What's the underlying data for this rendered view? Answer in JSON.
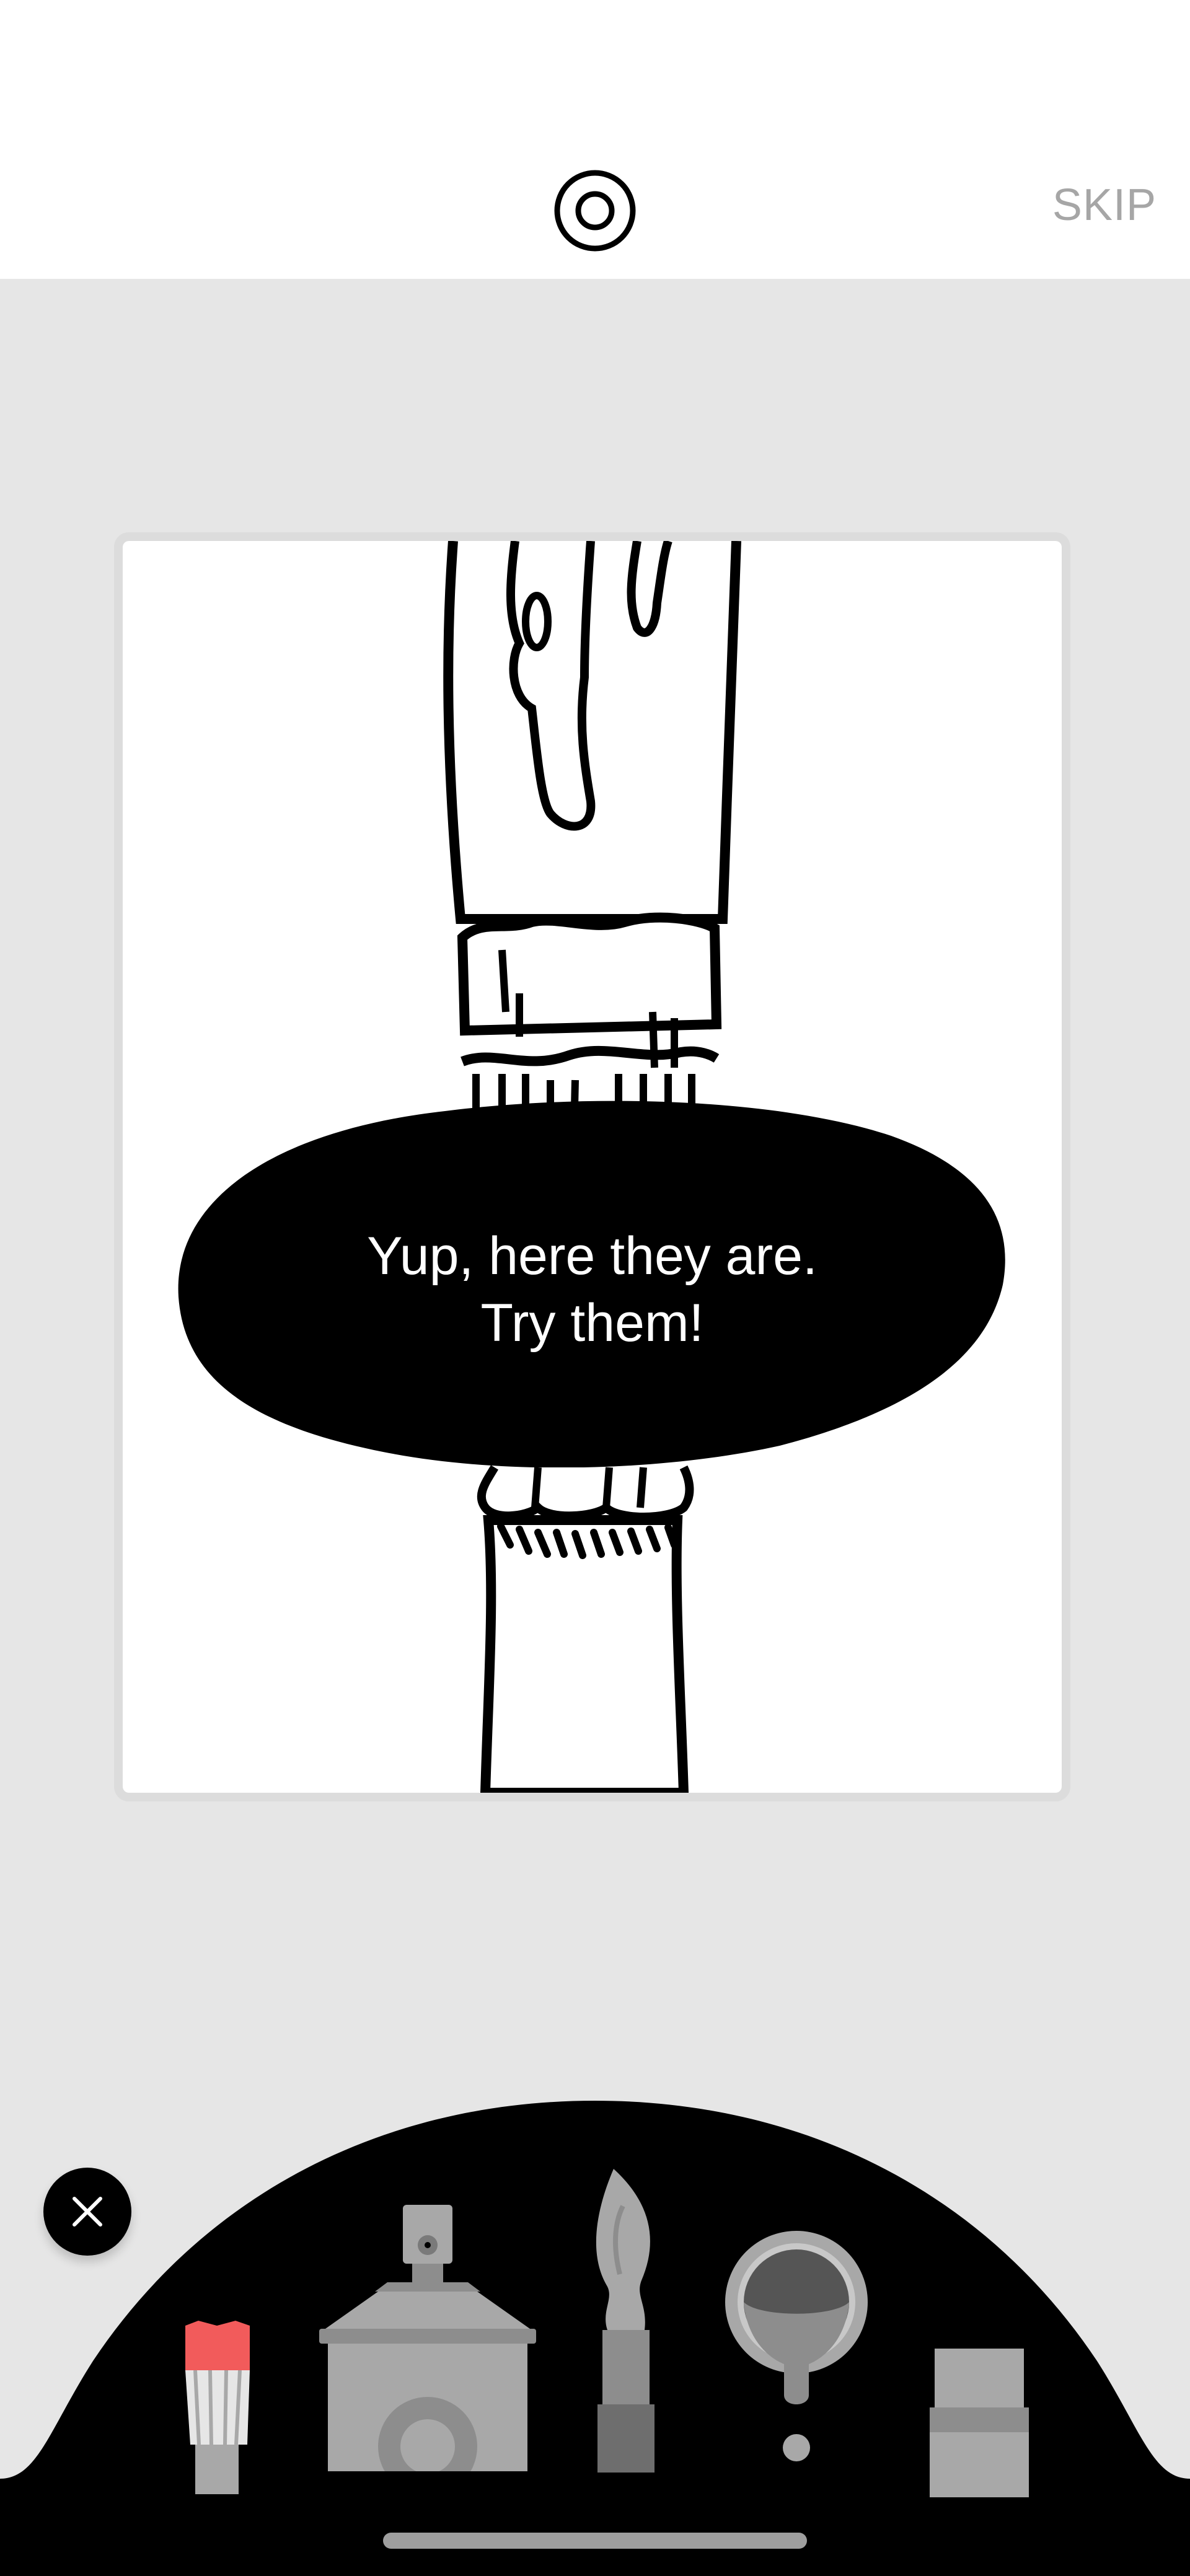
{
  "header": {
    "record_icon": "target-circle-icon",
    "skip_label": "SKIP"
  },
  "canvas": {
    "message_line1": "Yup, here they are.",
    "message_line2": "Try them!"
  },
  "toolbar": {
    "close_icon": "close-icon",
    "tools": [
      {
        "name": "marker",
        "icon": "marker-icon",
        "accent": "#f25b5b"
      },
      {
        "name": "spray-can",
        "icon": "spray-can-icon"
      },
      {
        "name": "paint-brush",
        "icon": "paint-brush-icon"
      },
      {
        "name": "paint-bucket",
        "icon": "paint-bucket-icon"
      },
      {
        "name": "eraser",
        "icon": "eraser-icon"
      }
    ]
  },
  "colors": {
    "background": "#e6e6e6",
    "tray": "#000000",
    "tool_gray": "#9a9a9a",
    "marker_tip": "#f25b5b"
  }
}
